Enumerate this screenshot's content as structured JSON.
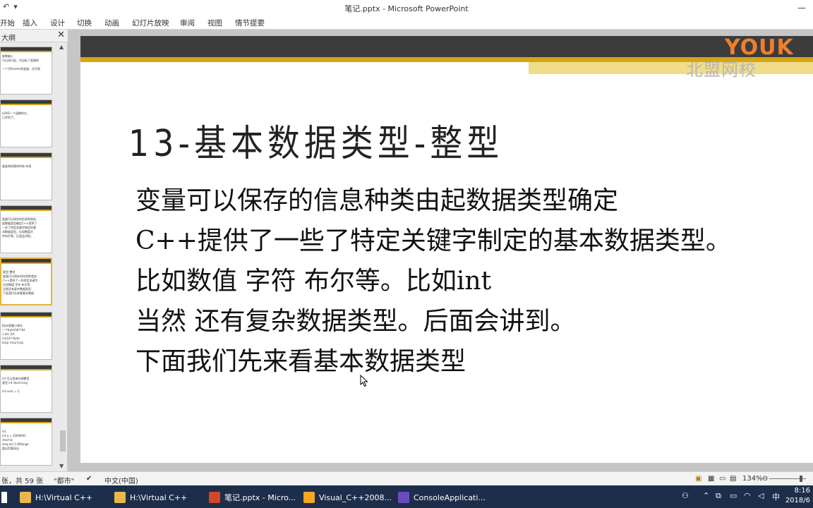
{
  "window": {
    "title": "笔记.pptx - Microsoft PowerPoint",
    "minimize": "—"
  },
  "ribbon": {
    "tabs": [
      "开始",
      "插入",
      "设计",
      "切换",
      "动画",
      "幻灯片放映",
      "审阅",
      "视图",
      "情节提要"
    ]
  },
  "left_pane": {
    "title": "大纲",
    "close": "✕",
    "thumbnails": [
      "参数输入\n可以执行此，它自标了变量的\n\n一个为Pointer的变量，它代表",
      "\nLOAD一个函数的它，\n已声明了。",
      "\n量变和纹理的所有-布局",
      "\n变量可以保存的信息种类由\n起数据类型确定C++提供了\n一些了特定关键字制定的基\n本数据类型。比如数值字\n符布尔等。后面会讲到。",
      "\n类型-整型\n变量可以保存的信息种类由\nC++提供了一些特定关键字\n比如数值 字符 布尔等\n当然还有复杂数据类型\n下面我们先来看基本数据",
      "\nByte是最小单位\n一个byte为8个bit\n1 bit: 0/1\nint占4个byte\nlong: long long",
      "\nint 可以用来存储整型\n类型 int short long\n\nint num = 1;",
      "\nint\nint a = 1000000;\nshort b;\nlong lon 5 的Range\n超出范围溢出"
    ]
  },
  "slide": {
    "title": "13-基本数据类型-整型",
    "body": [
      "变量可以保存的信息种类由起数据类型确定",
      "C++提供了一些了特定关键字制定的基本数据类型。",
      "比如数值 字符 布尔等。比如int",
      "当然 还有复杂数据类型。后面会讲到。",
      "下面我们先来看基本数据类型"
    ]
  },
  "watermark": {
    "logo": "YOUK",
    "text": "北盟网校"
  },
  "status": {
    "slide_info": "张，共 59 张",
    "theme": "\"都市\"",
    "language": "中文(中国)",
    "zoom": "134%",
    "zoom_level_fraction": 0.9
  },
  "taskbar": {
    "tasks": [
      {
        "label": "H:\\Virtual C++",
        "color": "#e8b84a"
      },
      {
        "label": "H:\\Virtual C++",
        "color": "#e8b84a"
      },
      {
        "label": "笔记.pptx - Micro...",
        "color": "#d24726"
      },
      {
        "label": "Visual_C++2008...",
        "color": "#f5a623"
      },
      {
        "label": "ConsoleApplicati...",
        "color": "#6c4bbf"
      }
    ],
    "tray_ime": "中",
    "clock_time": "8:16",
    "clock_date": "2018/6"
  },
  "colors": {
    "accent_gold": "#d4a514",
    "dark_bar": "#3c3c3c",
    "taskbar_bg": "#1c2e4a"
  }
}
